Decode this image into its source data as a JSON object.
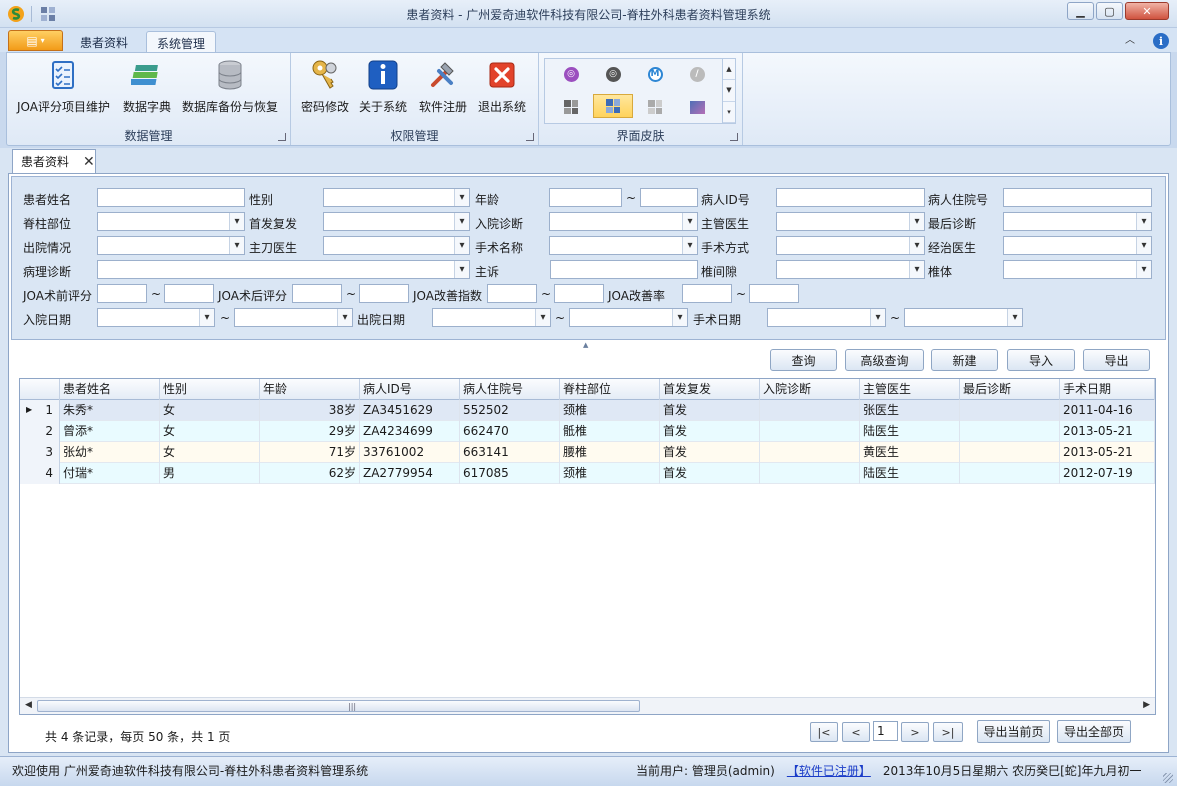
{
  "window": {
    "title": "患者资料 - 广州爱奇迪软件科技有限公司-脊柱外科患者资料管理系统"
  },
  "ribbon": {
    "tabs": [
      "患者资料",
      "系统管理"
    ],
    "groups": {
      "data_mgmt": {
        "label": "数据管理",
        "buttons": [
          "JOA评分项目维护",
          "数据字典",
          "数据库备份与恢复"
        ]
      },
      "perm_mgmt": {
        "label": "权限管理",
        "buttons": [
          "密码修改",
          "关于系统",
          "软件注册",
          "退出系统"
        ]
      },
      "skin": {
        "label": "界面皮肤"
      }
    }
  },
  "doc_tab": {
    "label": "患者资料"
  },
  "search": {
    "labels": {
      "name": "患者姓名",
      "gender": "性别",
      "age": "年龄",
      "patient_id": "病人ID号",
      "admission_no": "病人住院号",
      "spine_part": "脊柱部位",
      "first_relapse": "首发复发",
      "admit_diag": "入院诊断",
      "attending": "主管医生",
      "final_diag": "最后诊断",
      "discharge": "出院情况",
      "surgeon": "主刀医生",
      "surgery_name": "手术名称",
      "surgery_method": "手术方式",
      "treating": "经治医生",
      "pathology": "病理诊断",
      "complaint": "主诉",
      "disc_space": "椎间隙",
      "vertebra": "椎体",
      "joa_pre": "JOA术前评分",
      "joa_post": "JOA术后评分",
      "joa_index": "JOA改善指数",
      "joa_rate": "JOA改善率",
      "admit_date": "入院日期",
      "discharge_date": "出院日期",
      "surgery_date": "手术日期"
    },
    "tilde": "~"
  },
  "actions": [
    "查询",
    "高级查询",
    "新建",
    "导入",
    "导出"
  ],
  "table": {
    "columns": [
      "患者姓名",
      "性别",
      "年龄",
      "病人ID号",
      "病人住院号",
      "脊柱部位",
      "首发复发",
      "入院诊断",
      "主管医生",
      "最后诊断",
      "手术日期"
    ],
    "rows": [
      {
        "idx": "1",
        "name": "朱秀*",
        "gender": "女",
        "age": "38岁",
        "pid": "ZA3451629",
        "adm": "552502",
        "part": "颈椎",
        "first": "首发",
        "admit_diag": "",
        "doctor": "张医生",
        "final_diag": "",
        "date": "2011-04-16"
      },
      {
        "idx": "2",
        "name": "曾添*",
        "gender": "女",
        "age": "29岁",
        "pid": "ZA4234699",
        "adm": "662470",
        "part": "骶椎",
        "first": "首发",
        "admit_diag": "",
        "doctor": "陆医生",
        "final_diag": "",
        "date": "2013-05-21"
      },
      {
        "idx": "3",
        "name": "张幼*",
        "gender": "女",
        "age": "71岁",
        "pid": "33761002",
        "adm": "663141",
        "part": "腰椎",
        "first": "首发",
        "admit_diag": "",
        "doctor": "黄医生",
        "final_diag": "",
        "date": "2013-05-21"
      },
      {
        "idx": "4",
        "name": "付瑞*",
        "gender": "男",
        "age": "62岁",
        "pid": "ZA2779954",
        "adm": "617085",
        "part": "颈椎",
        "first": "首发",
        "admit_diag": "",
        "doctor": "陆医生",
        "final_diag": "",
        "date": "2012-07-19"
      }
    ]
  },
  "pager": {
    "summary": "共 4 条记录，每页 50 条，共 1 页",
    "first": "|<",
    "prev": "<",
    "page": "1",
    "next": ">",
    "last": ">|",
    "export_current": "导出当前页",
    "export_all": "导出全部页"
  },
  "status": {
    "welcome": "欢迎使用 广州爱奇迪软件科技有限公司-脊柱外科患者资料管理系统",
    "user": "当前用户: 管理员(admin)",
    "registered": "【软件已注册】",
    "date": "2013年10月5日星期六 农历癸巳[蛇]年九月初一"
  },
  "colors": {
    "accent": "#f29b18",
    "panel": "#dae6f4",
    "selected_row": "#dfe8f5"
  }
}
